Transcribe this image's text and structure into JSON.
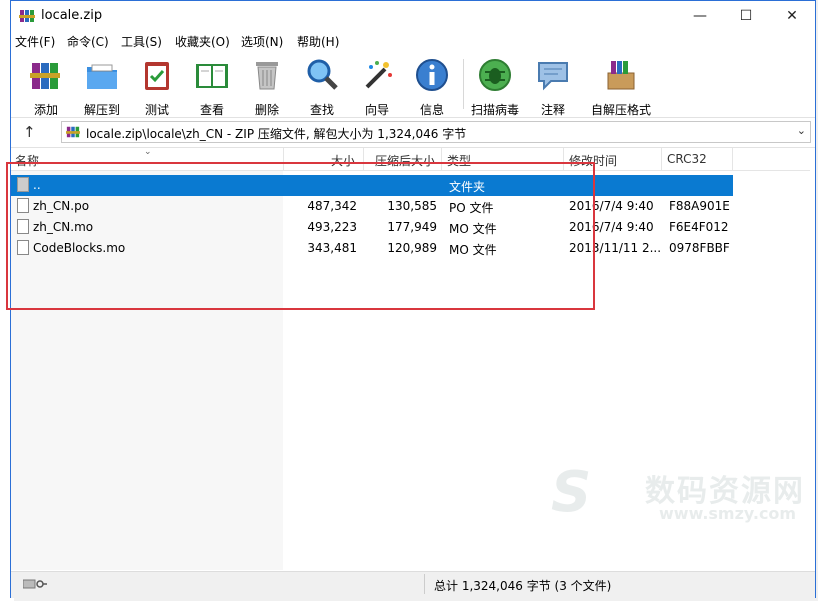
{
  "window": {
    "title": "locale.zip"
  },
  "menu": [
    {
      "label": "文件(F)"
    },
    {
      "label": "命令(C)"
    },
    {
      "label": "工具(S)"
    },
    {
      "label": "收藏夹(O)"
    },
    {
      "label": "选项(N)"
    },
    {
      "label": "帮助(H)"
    }
  ],
  "toolbar": [
    {
      "label": "添加",
      "icon": "books-add-icon"
    },
    {
      "label": "解压到",
      "icon": "folder-extract-icon"
    },
    {
      "label": "测试",
      "icon": "clipboard-test-icon"
    },
    {
      "label": "查看",
      "icon": "book-view-icon"
    },
    {
      "label": "删除",
      "icon": "trash-icon"
    },
    {
      "label": "查找",
      "icon": "magnifier-icon"
    },
    {
      "label": "向导",
      "icon": "wand-icon"
    },
    {
      "label": "信息",
      "icon": "info-icon"
    },
    {
      "label": "扫描病毒",
      "icon": "bug-scan-icon"
    },
    {
      "label": "注释",
      "icon": "comment-icon"
    },
    {
      "label": "自解压格式",
      "icon": "sfx-box-icon"
    }
  ],
  "address": {
    "text": "locale.zip\\locale\\zh_CN - ZIP 压缩文件, 解包大小为 1,324,046 字节"
  },
  "columns": [
    "名称",
    "大小",
    "压缩后大小",
    "类型",
    "修改时间",
    "CRC32"
  ],
  "files": [
    {
      "name": "..",
      "size": "",
      "packed": "",
      "type": "文件夹",
      "modified": "",
      "crc": "",
      "selected": true
    },
    {
      "name": "zh_CN.po",
      "size": "487,342",
      "packed": "130,585",
      "type": "PO 文件",
      "modified": "2016/7/4 9:40",
      "crc": "F88A901E",
      "selected": false
    },
    {
      "name": "zh_CN.mo",
      "size": "493,223",
      "packed": "177,949",
      "type": "MO 文件",
      "modified": "2016/7/4 9:40",
      "crc": "F6E4F012",
      "selected": false
    },
    {
      "name": "CodeBlocks.mo",
      "size": "343,481",
      "packed": "120,989",
      "type": "MO 文件",
      "modified": "2013/11/11 2...",
      "crc": "0978FBBF",
      "selected": false
    }
  ],
  "status": {
    "total": "总计 1,324,046 字节 (3 个文件)"
  },
  "watermark": {
    "logo": "S",
    "cn": "数码资源网",
    "url": "www.smzy.com"
  },
  "colors": {
    "selection": "#0a7ad1",
    "highlight_box": "#d9363e"
  }
}
